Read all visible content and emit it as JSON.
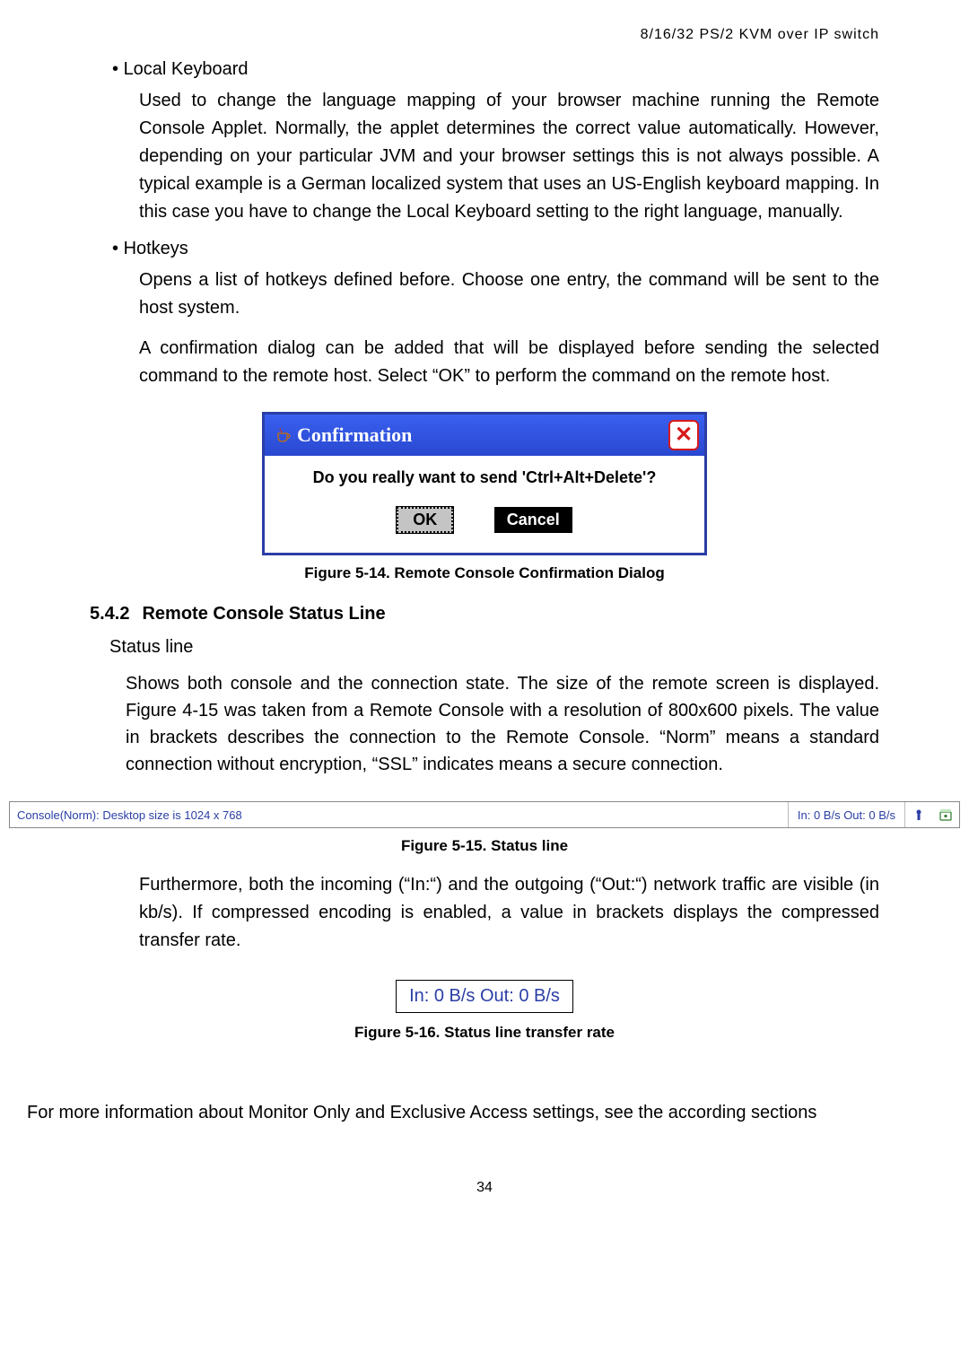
{
  "header": "8/16/32 PS/2 KVM over IP switch",
  "bullets": {
    "local_keyboard": "Local Keyboard",
    "local_keyboard_body": "Used to change the language mapping of your browser machine running the Remote Console Applet. Normally, the applet determines the correct value automatically. However, depending on your particular JVM and your browser settings this is not always possible. A typical example is a German localized system that uses an US-English keyboard mapping. In this case you have to change the Local Keyboard setting to the right language, manually.",
    "hotkeys": "Hotkeys",
    "hotkeys_body1": "Opens a list of hotkeys defined before. Choose one entry, the command will be sent to the host system.",
    "hotkeys_body2": "A confirmation dialog can be added that will be displayed before sending the selected command to the remote host. Select “OK” to perform the command on the remote host."
  },
  "dialog": {
    "title": "Confirmation",
    "message": "Do you really want to send 'Ctrl+Alt+Delete'?",
    "ok": "OK",
    "cancel": "Cancel"
  },
  "captions": {
    "fig14": "Figure 5-14. Remote Console Confirmation Dialog",
    "fig15": "Figure 5-15. Status line",
    "fig16": "Figure 5-16. Status line transfer rate"
  },
  "section": {
    "num": "5.4.2",
    "title": "Remote Console Status Line"
  },
  "status_line_heading": "Status line",
  "status_line_body": "Shows both console and the connection state. The size of the remote screen is displayed. Figure 4-15 was taken from a Remote Console with a resolution of 800x600 pixels. The value in brackets describes the connection to the Remote Console. “Norm” means a standard connection without encryption, “SSL” indicates means a secure connection.",
  "statusbar": {
    "left": "Console(Norm): Desktop size is 1024 x 768",
    "right": "In: 0 B/s Out: 0 B/s"
  },
  "furthermore": "Furthermore, both the incoming (“In:“) and the outgoing (“Out:“) network traffic are visible (in kb/s). If compressed encoding is enabled, a value in brackets displays the compressed transfer rate.",
  "rate_box": "In: 0 B/s Out: 0 B/s",
  "more_info": "For more information about Monitor Only and Exclusive Access settings, see the according sections",
  "page_number": "34"
}
